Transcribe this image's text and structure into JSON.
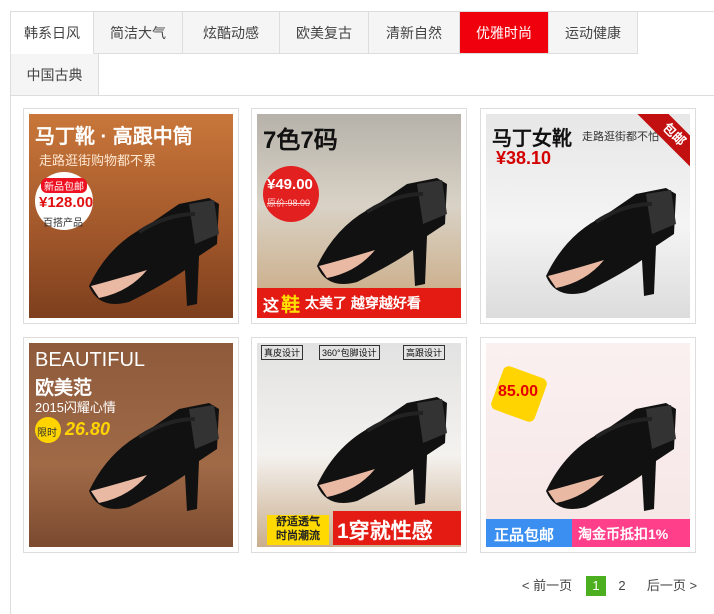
{
  "tabs": [
    {
      "label": "韩系日风",
      "state": "active"
    },
    {
      "label": "简洁大气",
      "state": "normal"
    },
    {
      "label": "炫酷动感",
      "state": "normal"
    },
    {
      "label": "欧美复古",
      "state": "normal"
    },
    {
      "label": "清新自然",
      "state": "normal"
    },
    {
      "label": "优雅时尚",
      "state": "hot"
    },
    {
      "label": "运动健康",
      "state": "normal"
    },
    {
      "label": "中国古典",
      "state": "normal"
    }
  ],
  "products": [
    {
      "headline": "马丁靴 · 高跟中筒",
      "subline": "走路逛街购物都不累",
      "badge_top": "新品包邮",
      "price": "¥128.00",
      "note": "百搭产品"
    },
    {
      "headline": "7色7码",
      "price": "¥49.00",
      "old_price": "原价:98.00",
      "banner_a": "这",
      "banner_b": "鞋",
      "banner_c": "太美了 越穿越好看"
    },
    {
      "headline": "马丁女靴",
      "subline": "走路逛街都不怕",
      "price": "¥38.10",
      "corner": "包邮"
    },
    {
      "headline": "BEAUTIFUL",
      "subline": "欧美范",
      "line3": "2015闪耀心情",
      "badge": "限时",
      "price": "26.80"
    },
    {
      "tags": [
        "真皮设计",
        "360°包脚设计",
        "高跟设计"
      ],
      "banner_left": "舒适透气\n时尚潮流",
      "banner_right": "1穿就性感"
    },
    {
      "price": "85.00",
      "banner_left": "正品包邮",
      "banner_right": "淘金币抵扣1%"
    }
  ],
  "pagination": {
    "prev": "< 前一页",
    "pages": [
      "1",
      "2"
    ],
    "current": "1",
    "next": "后一页 >"
  },
  "colors": {
    "hot_tab": "#f0000c",
    "current_page": "#4caf20"
  }
}
